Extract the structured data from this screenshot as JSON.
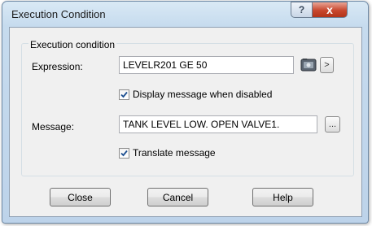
{
  "window": {
    "title": "Execution Condition",
    "help_glyph": "?",
    "close_glyph": "x"
  },
  "group": {
    "legend": "Execution condition"
  },
  "expression": {
    "label": "Expression:",
    "value": "LEVELR201 GE 50",
    "browse_icon": "expression-editor-icon",
    "more_glyph": ">"
  },
  "display_message": {
    "label": "Display message when disabled",
    "checked": true
  },
  "message": {
    "label": "Message:",
    "value": "TANK LEVEL LOW. OPEN VALVE1.",
    "browse_glyph": "..."
  },
  "translate": {
    "label": "Translate message",
    "checked": true
  },
  "buttons": {
    "close": "Close",
    "cancel": "Cancel",
    "help": "Help"
  },
  "colors": {
    "title_bar": "#c6dbee",
    "close_button": "#c8472d",
    "dialog_face": "#f0f0f0",
    "checkbox_mark": "#1d4f91"
  }
}
